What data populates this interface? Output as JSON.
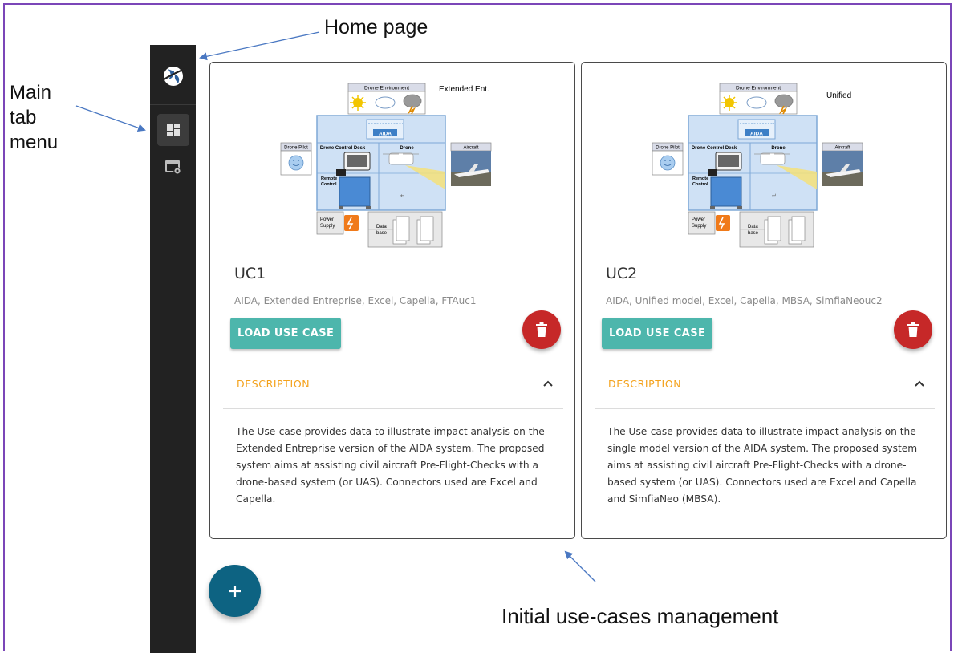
{
  "annotations": {
    "home_page": "Home page",
    "main_tab_menu": [
      "Main",
      "tab",
      "menu"
    ],
    "use_cases_management": "Initial use-cases management"
  },
  "sidebar": {
    "logo_icon": "globe-logo-icon",
    "items": [
      {
        "icon": "dashboard-icon",
        "active": true
      },
      {
        "icon": "settings-window-icon",
        "active": false
      }
    ]
  },
  "diagram_labels": {
    "drone_environment": "Drone Environment",
    "drone_pilot": "Drone Pilot",
    "drone_control_desk": "Drone Control Desk",
    "drone": "Drone",
    "aircraft": "Aircraft",
    "remote_control": [
      "Remote",
      "Control"
    ],
    "power_supply": [
      "Power",
      "Supply"
    ],
    "data_base": [
      "Data",
      "base"
    ],
    "aida": "AIDA"
  },
  "cards": [
    {
      "diagram_caption": "Extended Ent.",
      "title": "UC1",
      "subtitle": "AIDA, Extended Entreprise, Excel, Capella, FTAuc1",
      "load_label": "LOAD USE CASE",
      "description_label": "DESCRIPTION",
      "description": "The Use-case provides data to illustrate impact analysis on the Extended Entreprise version of the AIDA system. The proposed system aims at assisting civil aircraft Pre-Flight-Checks with a drone-based system (or UAS). Connectors used are Excel and Capella."
    },
    {
      "diagram_caption": "Unified",
      "title": "UC2",
      "subtitle": "AIDA, Unified model, Excel, Capella, MBSA, SimfiaNeouc2",
      "load_label": "LOAD USE CASE",
      "description_label": "DESCRIPTION",
      "description": "The Use-case provides data to illustrate impact analysis on the single model version of the AIDA system. The proposed system aims at assisting civil aircraft Pre-Flight-Checks with a drone-based system (or UAS). Connectors used are Excel and Capella and SimfiaNeo (MBSA)."
    }
  ],
  "fab": {
    "label": "+"
  },
  "colors": {
    "sidebar_bg": "#222222",
    "load_button": "#4db6ac",
    "delete_button": "#c62828",
    "description_accent": "#f4a21c",
    "fab": "#0d6382",
    "frame_border": "#7b46b8",
    "annotation_arrow": "#4a78c2"
  }
}
